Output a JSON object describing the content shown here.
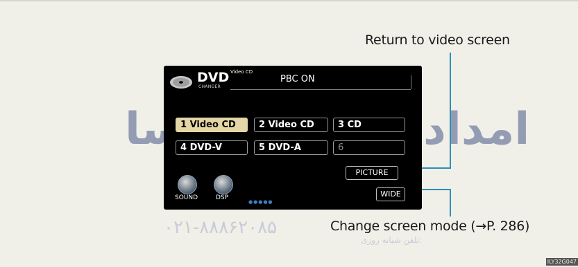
{
  "callouts": {
    "return_label": "Return to video screen",
    "mode_label": "Change screen mode (→P. 286)"
  },
  "header": {
    "logo_text": "DVD",
    "logo_sub": "CHANGER",
    "mode_label": "Video CD",
    "status": "PBC ON"
  },
  "discs": [
    {
      "label": "1 Video CD",
      "selected": true
    },
    {
      "label": "2 Video CD",
      "selected": false
    },
    {
      "label": "3 CD",
      "selected": false
    },
    {
      "label": "4 DVD-V",
      "selected": false
    },
    {
      "label": "5 DVD-A",
      "selected": false
    },
    {
      "label": "6",
      "selected": false
    }
  ],
  "buttons": {
    "picture": "PICTURE",
    "wide": "WIDE",
    "sound": "SOUND",
    "dsp": "DSP"
  },
  "indicator": "●●●●●",
  "watermark": {
    "phone": "۰۲۱-۸۸۸۶۲۰۸۵",
    "phone_caption": "تلفن شبانه روزی:",
    "logo_text": "امداد خودرو فارسا"
  },
  "figure_code": "ILY32G047"
}
